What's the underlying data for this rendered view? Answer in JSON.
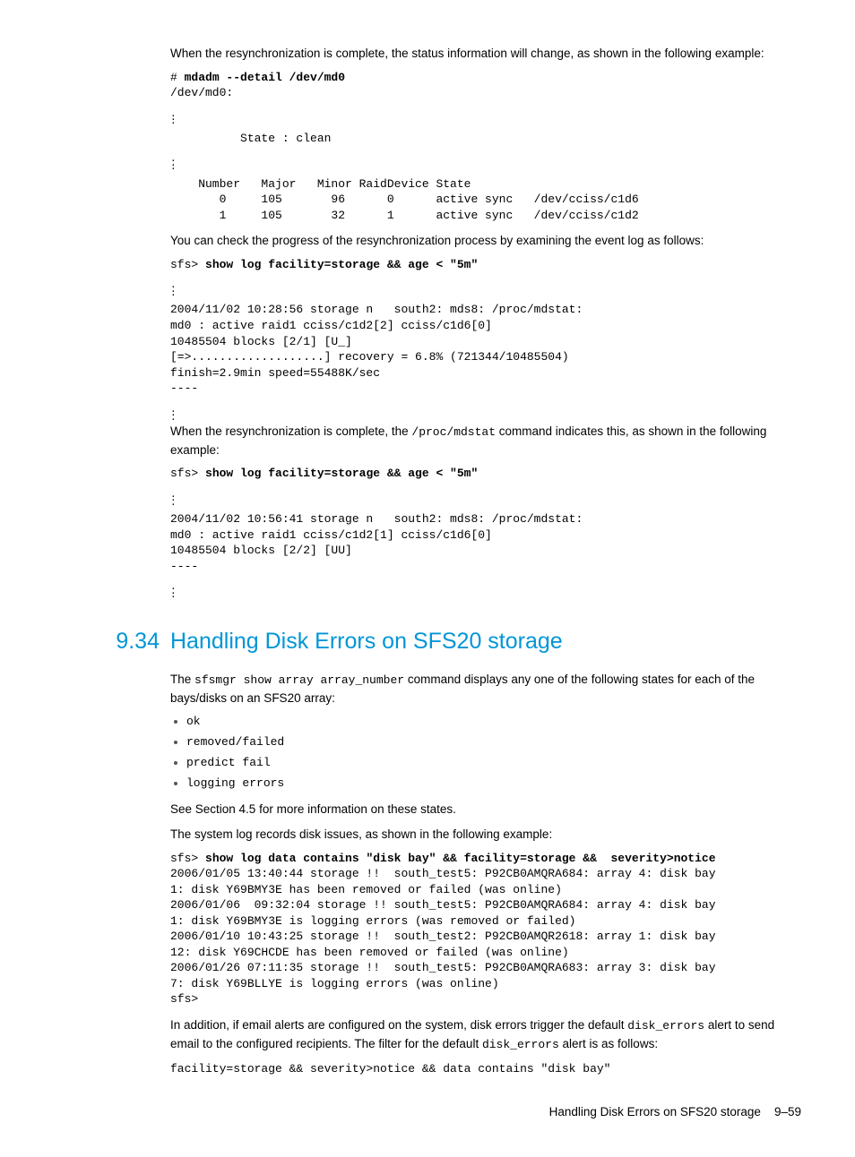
{
  "p1": "When the resynchronization is complete, the status information will change, as shown in the following example:",
  "code1_prompt": "# ",
  "code1_cmd": "mdadm --detail /dev/md0",
  "code1_body1": "/dev/md0:",
  "code1_body2": "          State : clean",
  "code1_body3": "    Number   Major   Minor RaidDevice State\n       0     105       96      0      active sync   /dev/cciss/c1d6\n       1     105       32      1      active sync   /dev/cciss/c1d2",
  "p2": "You can check the progress of the resynchronization process by examining the event log as follows:",
  "code2_prompt": "sfs> ",
  "code2_cmd": "show log facility=storage && age < \"5m\"",
  "code2_body": "2004/11/02 10:28:56 storage n   south2: mds8: /proc/mdstat:\nmd0 : active raid1 cciss/c1d2[2] cciss/c1d6[0]\n10485504 blocks [2/1] [U_]\n[=>...................] recovery = 6.8% (721344/10485504)\nfinish=2.9min speed=55488K/sec\n----",
  "p3_a": "When the resynchronization is complete, the ",
  "p3_code": "/proc/mdstat",
  "p3_b": " command indicates this, as shown in the following example:",
  "code3_prompt": "sfs> ",
  "code3_cmd": "show log facility=storage && age < \"5m\"",
  "code3_body": "2004/11/02 10:56:41 storage n   south2: mds8: /proc/mdstat:\nmd0 : active raid1 cciss/c1d2[1] cciss/c1d6[0]\n10485504 blocks [2/2] [UU]\n----",
  "section_num": "9.34",
  "section_title": "Handling Disk Errors on SFS20 storage",
  "p4_a": "The ",
  "p4_code1": "sfsmgr show array ",
  "p4_code2": "array_number",
  "p4_b": " command displays any one of the following states for each of the bays/disks on an SFS20 array:",
  "bullets": [
    "ok",
    "removed/failed",
    "predict fail",
    "logging errors"
  ],
  "p5": "See Section 4.5 for more information on these states.",
  "p6": "The system log records disk issues, as shown in the following example:",
  "code4_prompt": "sfs> ",
  "code4_cmd": "show log data contains \"disk bay\" && facility=storage &&  severity>notice",
  "code4_body": "2006/01/05 13:40:44 storage !!  south_test5: P92CB0AMQRA684: array 4: disk bay\n1: disk Y69BMY3E has been removed or failed (was online)\n2006/01/06  09:32:04 storage !! south_test5: P92CB0AMQRA684: array 4: disk bay\n1: disk Y69BMY3E is logging errors (was removed or failed)\n2006/01/10 10:43:25 storage !!  south_test2: P92CB0AMQR2618: array 1: disk bay\n12: disk Y69CHCDE has been removed or failed (was online)\n2006/01/26 07:11:35 storage !!  south_test5: P92CB0AMQRA683: array 3: disk bay\n7: disk Y69BLLYE is logging errors (was online)\nsfs>",
  "p7_a": "In addition, if email alerts are configured on the system, disk errors trigger the default ",
  "p7_code1": "disk_errors",
  "p7_b": " alert to send email to the configured recipients. The filter for the default ",
  "p7_code2": "disk_errors",
  "p7_c": " alert is as follows:",
  "code5": "facility=storage && severity>notice && data contains \"disk bay\"",
  "footer_text": "Handling Disk Errors on SFS20 storage",
  "footer_page": "9–59"
}
